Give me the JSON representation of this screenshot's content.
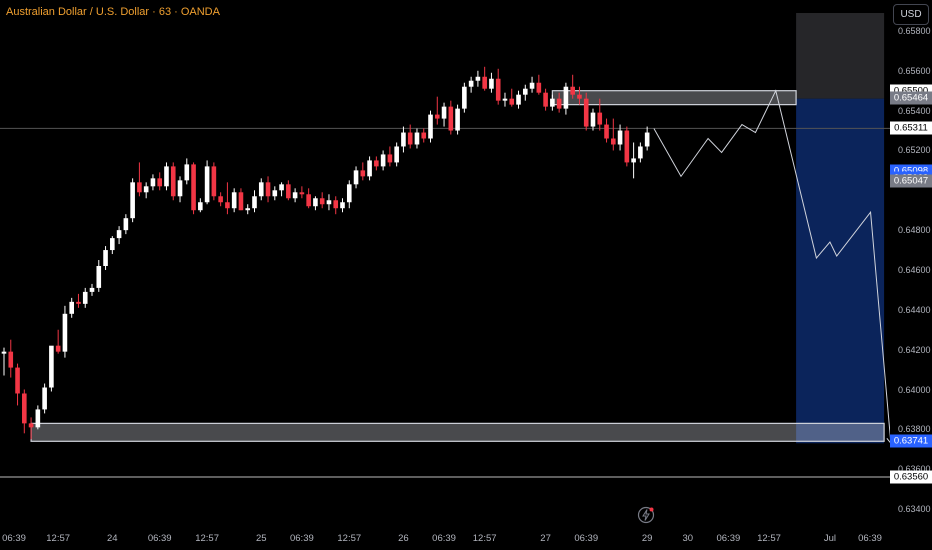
{
  "header": {
    "title": "Australian Dollar / U.S. Dollar · 63 · OANDA"
  },
  "currency_button": {
    "label": "USD"
  },
  "colors": {
    "up": "#ffffff",
    "down": "#f23645",
    "target_zone": "#0d2a6b",
    "stop_zone": "#2a2a2e",
    "badge_blue": "#2962ff",
    "title": "#f0a030"
  },
  "price_axis": {
    "ticks": [
      "0.65800",
      "0.65600",
      "0.65400",
      "0.65200",
      "0.64800",
      "0.64600",
      "0.64400",
      "0.64200",
      "0.64000",
      "0.63800",
      "0.63600",
      "0.63400"
    ],
    "badges": [
      {
        "label": "0.65500",
        "price": 0.655,
        "style": "light"
      },
      {
        "label": "0.65464",
        "price": 0.65464,
        "style": "grey"
      },
      {
        "label": "0.65311",
        "price": 0.65311,
        "style": "light"
      },
      {
        "label": "0.65098",
        "price": 0.65098,
        "style": "blue"
      },
      {
        "label": "0.65062",
        "price": 0.65062,
        "style": "blue"
      },
      {
        "label": "0.65047",
        "price": 0.65047,
        "style": "grey"
      },
      {
        "label": "0.63741",
        "price": 0.63741,
        "style": "blue"
      },
      {
        "label": "0.63561",
        "price": 0.63561,
        "style": "light"
      },
      {
        "label": "0.63560",
        "price": 0.6356,
        "style": "light"
      }
    ]
  },
  "time_axis": {
    "ticks": [
      {
        "label": "06:39",
        "i": 0
      },
      {
        "label": "12:57",
        "i": 8
      },
      {
        "label": "24",
        "i": 16
      },
      {
        "label": "06:39",
        "i": 23
      },
      {
        "label": "12:57",
        "i": 30
      },
      {
        "label": "25",
        "i": 38
      },
      {
        "label": "06:39",
        "i": 44
      },
      {
        "label": "12:57",
        "i": 51
      },
      {
        "label": "26",
        "i": 59
      },
      {
        "label": "06:39",
        "i": 65
      },
      {
        "label": "12:57",
        "i": 71
      },
      {
        "label": "27",
        "i": 80
      },
      {
        "label": "06:39",
        "i": 86
      },
      {
        "label": "29",
        "i": 95
      },
      {
        "label": "30",
        "i": 101
      },
      {
        "label": "06:39",
        "i": 107
      },
      {
        "label": "12:57",
        "i": 113
      },
      {
        "label": "Jul",
        "i": 122
      },
      {
        "label": "06:39",
        "i": 128
      }
    ]
  },
  "chart_data": {
    "type": "candlestick",
    "symbol": "AUDUSD",
    "ylim": [
      0.6337,
      0.6588
    ],
    "candles": [
      [
        0.6418,
        0.6421,
        0.6407,
        0.6419
      ],
      [
        0.6419,
        0.6425,
        0.6406,
        0.6411
      ],
      [
        0.6411,
        0.6413,
        0.6392,
        0.6398
      ],
      [
        0.6398,
        0.64,
        0.6378,
        0.6383
      ],
      [
        0.6383,
        0.6386,
        0.6375,
        0.6381
      ],
      [
        0.6381,
        0.6392,
        0.638,
        0.639
      ],
      [
        0.639,
        0.6403,
        0.6388,
        0.6401
      ],
      [
        0.6401,
        0.6418,
        0.6399,
        0.6422
      ],
      [
        0.6422,
        0.643,
        0.6418,
        0.6419
      ],
      [
        0.6419,
        0.6442,
        0.6416,
        0.6438
      ],
      [
        0.6438,
        0.6446,
        0.6436,
        0.6444
      ],
      [
        0.6444,
        0.6448,
        0.6441,
        0.6443
      ],
      [
        0.6443,
        0.6451,
        0.6441,
        0.6449
      ],
      [
        0.6449,
        0.6453,
        0.6447,
        0.6451
      ],
      [
        0.6451,
        0.6465,
        0.6449,
        0.6462
      ],
      [
        0.6462,
        0.6472,
        0.646,
        0.647
      ],
      [
        0.647,
        0.6477,
        0.6468,
        0.6476
      ],
      [
        0.6476,
        0.6482,
        0.6473,
        0.648
      ],
      [
        0.648,
        0.6488,
        0.6478,
        0.6486
      ],
      [
        0.6486,
        0.6506,
        0.6484,
        0.6504
      ],
      [
        0.6504,
        0.6514,
        0.6497,
        0.6499
      ],
      [
        0.6499,
        0.6504,
        0.6496,
        0.6502
      ],
      [
        0.6502,
        0.6508,
        0.65,
        0.6506
      ],
      [
        0.6506,
        0.6509,
        0.65,
        0.6502
      ],
      [
        0.6502,
        0.6514,
        0.65,
        0.6512
      ],
      [
        0.6512,
        0.6514,
        0.6495,
        0.6497
      ],
      [
        0.6497,
        0.6507,
        0.6494,
        0.6505
      ],
      [
        0.6505,
        0.6516,
        0.6503,
        0.6513
      ],
      [
        0.6513,
        0.6514,
        0.6488,
        0.649
      ],
      [
        0.649,
        0.6496,
        0.6489,
        0.6494
      ],
      [
        0.6494,
        0.6515,
        0.6493,
        0.6512
      ],
      [
        0.6512,
        0.6514,
        0.6495,
        0.6497
      ],
      [
        0.6497,
        0.6499,
        0.6492,
        0.6494
      ],
      [
        0.6494,
        0.6504,
        0.6488,
        0.6491
      ],
      [
        0.6491,
        0.6501,
        0.6489,
        0.6499
      ],
      [
        0.6499,
        0.6501,
        0.649,
        0.649
      ],
      [
        0.649,
        0.6493,
        0.6488,
        0.6491
      ],
      [
        0.6491,
        0.65,
        0.6489,
        0.6497
      ],
      [
        0.6497,
        0.6506,
        0.6495,
        0.6504
      ],
      [
        0.6504,
        0.6507,
        0.6494,
        0.6497
      ],
      [
        0.6497,
        0.6502,
        0.6495,
        0.65
      ],
      [
        0.65,
        0.6504,
        0.6497,
        0.6503
      ],
      [
        0.6503,
        0.6505,
        0.6495,
        0.6496
      ],
      [
        0.6496,
        0.6501,
        0.6494,
        0.6499
      ],
      [
        0.6499,
        0.6502,
        0.6496,
        0.6498
      ],
      [
        0.6498,
        0.6501,
        0.6491,
        0.6492
      ],
      [
        0.6492,
        0.6497,
        0.649,
        0.6496
      ],
      [
        0.6496,
        0.6499,
        0.6491,
        0.6493
      ],
      [
        0.6493,
        0.6498,
        0.649,
        0.6495
      ],
      [
        0.6495,
        0.6497,
        0.6488,
        0.6491
      ],
      [
        0.6491,
        0.6496,
        0.6489,
        0.6494
      ],
      [
        0.6494,
        0.6505,
        0.6491,
        0.6503
      ],
      [
        0.6503,
        0.6512,
        0.6501,
        0.651
      ],
      [
        0.651,
        0.6514,
        0.6505,
        0.6507
      ],
      [
        0.6507,
        0.6517,
        0.6505,
        0.6515
      ],
      [
        0.6515,
        0.6517,
        0.651,
        0.6512
      ],
      [
        0.6512,
        0.652,
        0.651,
        0.6518
      ],
      [
        0.6518,
        0.6522,
        0.6512,
        0.6514
      ],
      [
        0.6514,
        0.6524,
        0.6512,
        0.6522
      ],
      [
        0.6522,
        0.6532,
        0.6519,
        0.6529
      ],
      [
        0.6529,
        0.6533,
        0.6521,
        0.6523
      ],
      [
        0.6523,
        0.6531,
        0.6521,
        0.6529
      ],
      [
        0.6529,
        0.6531,
        0.6524,
        0.6526
      ],
      [
        0.6526,
        0.654,
        0.6524,
        0.6538
      ],
      [
        0.6538,
        0.6547,
        0.6533,
        0.6536
      ],
      [
        0.6536,
        0.6544,
        0.6532,
        0.6542
      ],
      [
        0.6542,
        0.6545,
        0.6528,
        0.653
      ],
      [
        0.653,
        0.6543,
        0.6528,
        0.6541
      ],
      [
        0.6541,
        0.6554,
        0.6539,
        0.6552
      ],
      [
        0.6552,
        0.6557,
        0.6549,
        0.6555
      ],
      [
        0.6555,
        0.656,
        0.6552,
        0.6557
      ],
      [
        0.6557,
        0.6562,
        0.655,
        0.6551
      ],
      [
        0.6551,
        0.6559,
        0.6549,
        0.6556
      ],
      [
        0.6556,
        0.6561,
        0.6543,
        0.6545
      ],
      [
        0.6545,
        0.6549,
        0.6542,
        0.6546
      ],
      [
        0.6546,
        0.6551,
        0.6542,
        0.6543
      ],
      [
        0.6543,
        0.655,
        0.6541,
        0.6548
      ],
      [
        0.6548,
        0.6553,
        0.6545,
        0.6551
      ],
      [
        0.6551,
        0.6557,
        0.6549,
        0.6554
      ],
      [
        0.6554,
        0.6558,
        0.6548,
        0.6549
      ],
      [
        0.6549,
        0.6551,
        0.654,
        0.6542
      ],
      [
        0.6542,
        0.6548,
        0.654,
        0.6546
      ],
      [
        0.6546,
        0.6549,
        0.6539,
        0.6541
      ],
      [
        0.6541,
        0.6554,
        0.6538,
        0.6552
      ],
      [
        0.6552,
        0.6558,
        0.6546,
        0.6548
      ],
      [
        0.6548,
        0.6552,
        0.6543,
        0.6546
      ],
      [
        0.6546,
        0.6549,
        0.653,
        0.6532
      ],
      [
        0.6532,
        0.6541,
        0.653,
        0.6539
      ],
      [
        0.6539,
        0.6546,
        0.653,
        0.6533
      ],
      [
        0.6533,
        0.6536,
        0.6524,
        0.6526
      ],
      [
        0.6526,
        0.6536,
        0.652,
        0.6523
      ],
      [
        0.6523,
        0.6533,
        0.652,
        0.653
      ],
      [
        0.653,
        0.6532,
        0.6512,
        0.6514
      ],
      [
        0.6514,
        0.6524,
        0.6506,
        0.6516
      ],
      [
        0.6516,
        0.6524,
        0.6514,
        0.6522
      ],
      [
        0.6522,
        0.6532,
        0.652,
        0.6529
      ]
    ],
    "projection_path": [
      [
        96,
        0.6531
      ],
      [
        100,
        0.6507
      ],
      [
        104,
        0.6526
      ],
      [
        106,
        0.6519
      ],
      [
        109,
        0.6533
      ],
      [
        111,
        0.6529
      ],
      [
        114,
        0.655
      ],
      [
        120,
        0.6466
      ],
      [
        122,
        0.6474
      ],
      [
        123,
        0.6467
      ],
      [
        128,
        0.6489
      ],
      [
        131,
        0.6373
      ]
    ],
    "zones": [
      {
        "name": "stop",
        "from_i": 117,
        "to_i": 130,
        "top": 0.6589,
        "bottom": 0.6546
      },
      {
        "name": "target",
        "from_i": 117,
        "to_i": 130,
        "top": 0.6546,
        "bottom": 0.6373
      }
    ],
    "boxes": [
      {
        "from_i": 81,
        "to_i": 117,
        "top": 0.655,
        "bottom": 0.6543
      },
      {
        "from_i": 4,
        "to_i": 130,
        "top": 0.6383,
        "bottom": 0.6374
      }
    ],
    "hlines": [
      0.65311,
      0.63561
    ]
  }
}
